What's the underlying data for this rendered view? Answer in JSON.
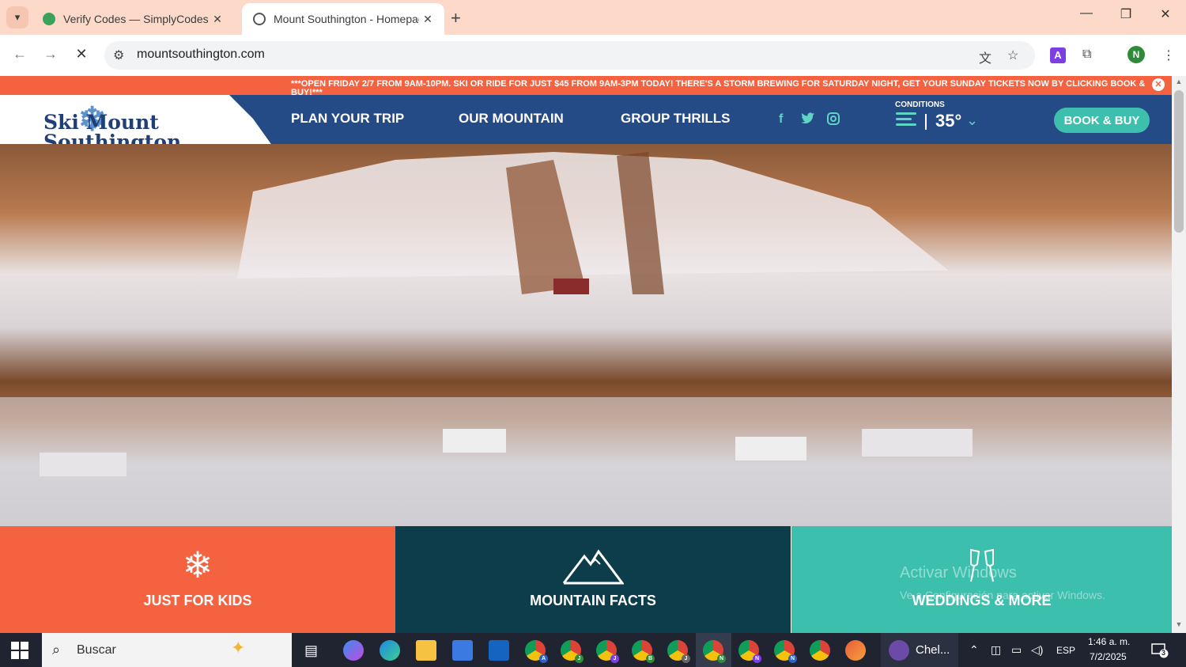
{
  "browser": {
    "tabs": [
      {
        "title": "Verify Codes — SimplyCodes",
        "active": false
      },
      {
        "title": "Mount Southington - Homepag",
        "active": true
      }
    ],
    "url": "mountsouthington.com"
  },
  "site": {
    "promo": "***OPEN FRIDAY 2/7 FROM 9AM-10PM. SKI OR RIDE FOR JUST $45 FROM 9AM-3PM TODAY! THERE'S A STORM BREWING FOR SATURDAY NIGHT, GET YOUR SUNDAY TICKETS NOW BY CLICKING BOOK & BUY!***",
    "logo_line1": "Ski Mount",
    "logo_line2": "Southington",
    "nav": [
      "PLAN YOUR TRIP",
      "OUR MOUNTAIN",
      "GROUP THRILLS"
    ],
    "conditions_label": "CONDITIONS",
    "temperature": "35°",
    "book_button": "BOOK & BUY",
    "tiles": [
      "JUST FOR KIDS",
      "MOUNTAIN FACTS",
      "WEDDINGS & MORE"
    ]
  },
  "watermark": {
    "title": "Activar Windows",
    "subtitle": "Ve a Configuración para activar Windows."
  },
  "taskbar": {
    "search_placeholder": "Buscar",
    "app_label": "Chel...",
    "language": "ESP",
    "time": "1:46 a. m.",
    "date": "7/2/2025",
    "notifications": "3",
    "chrome_badges": [
      "A",
      "J",
      "J",
      "B",
      "J",
      "N",
      "N",
      "N"
    ]
  },
  "colors": {
    "accent_orange": "#f5623f",
    "nav_blue": "#254b86",
    "teal": "#3dbfae",
    "dark_teal": "#0d3d4a",
    "tabstrip": "#fcd9c8"
  }
}
